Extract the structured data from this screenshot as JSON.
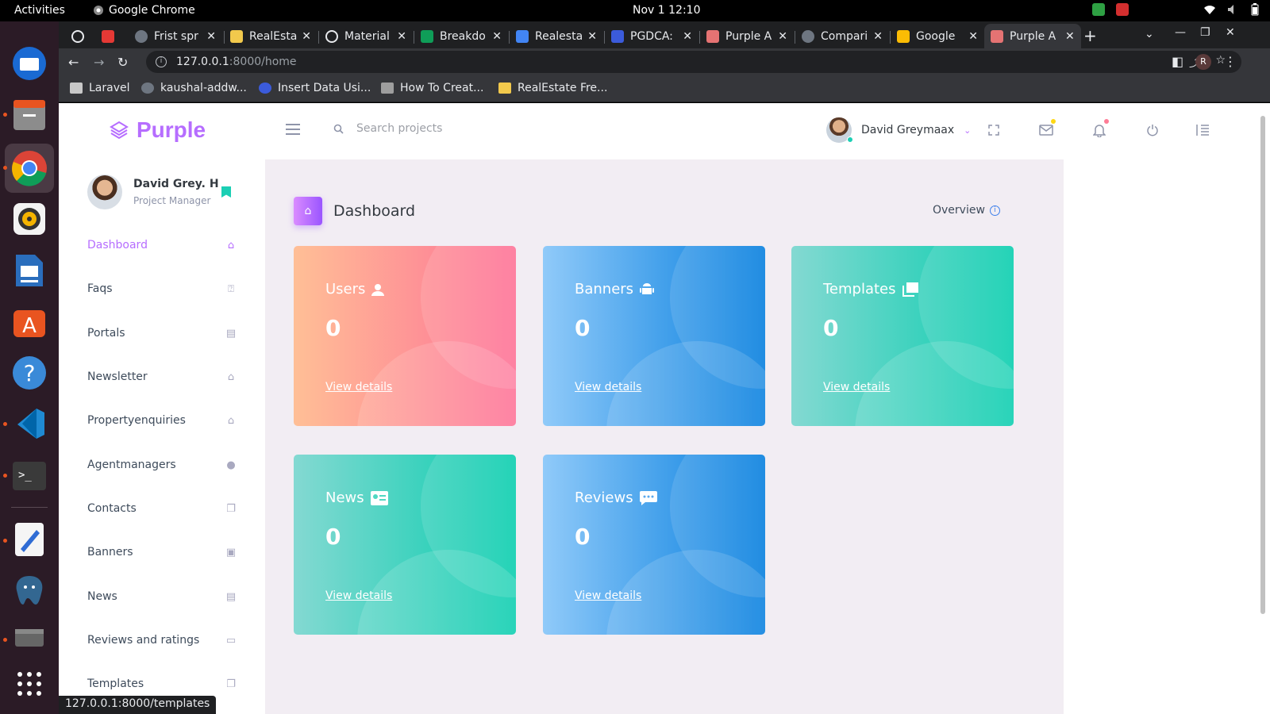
{
  "system": {
    "activities": "Activities",
    "app_name": "Google Chrome",
    "clock": "Nov 1  12:10"
  },
  "browser": {
    "tabs": [
      {
        "title": "",
        "color": "#e8eaed"
      },
      {
        "title": "",
        "color": "#e53935"
      },
      {
        "title": "Frist spr",
        "color": "#6e7681"
      },
      {
        "title": "RealEsta",
        "color": "#f2c94c"
      },
      {
        "title": "Material",
        "color": "#e8eaed"
      },
      {
        "title": "Breakdo",
        "color": "#0f9d58"
      },
      {
        "title": "Realesta",
        "color": "#4285f4"
      },
      {
        "title": "PGDCA:",
        "color": "#3b5bdb"
      },
      {
        "title": "Purple A",
        "color": "#e57373"
      },
      {
        "title": "Compari",
        "color": "#6e7681"
      },
      {
        "title": "Google",
        "color": "#fbbc04"
      },
      {
        "title": "Purple A",
        "color": "#e57373"
      }
    ],
    "url_host": "127.0.0.1",
    "url_path": ":8000/home",
    "profile_initial": "R",
    "bookmarks": [
      "Laravel",
      "kaushal-addw...",
      "Insert Data Usi...",
      "How To Creat...",
      "RealEstate Fre..."
    ],
    "status_url": "127.0.0.1:8000/templates"
  },
  "app": {
    "brand": "Purple",
    "search_placeholder": "Search projects",
    "user_name": "David Greymaax",
    "profile": {
      "name": "David Grey. H",
      "role": "Project Manager"
    },
    "menu": [
      {
        "label": "Dashboard",
        "icon": "home-icon"
      },
      {
        "label": "Faqs",
        "icon": "question-icon"
      },
      {
        "label": "Portals",
        "icon": "id-card-icon"
      },
      {
        "label": "Newsletter",
        "icon": "home-icon"
      },
      {
        "label": "Propertyenquiries",
        "icon": "home-icon"
      },
      {
        "label": "Agentmanagers",
        "icon": "user-icon"
      },
      {
        "label": "Contacts",
        "icon": "copy-icon"
      },
      {
        "label": "Banners",
        "icon": "android-icon"
      },
      {
        "label": "News",
        "icon": "id-card-icon"
      },
      {
        "label": "Reviews and ratings",
        "icon": "message-icon"
      },
      {
        "label": "Templates",
        "icon": "copy-icon"
      }
    ],
    "page_title": "Dashboard",
    "overview": "Overview",
    "cards": [
      {
        "label": "Users",
        "value": "0",
        "link": "View details",
        "icon": "user-icon"
      },
      {
        "label": "Banners",
        "value": "0",
        "link": "View details",
        "icon": "android-icon"
      },
      {
        "label": "Templates",
        "value": "0",
        "link": "View details",
        "icon": "copy-icon"
      },
      {
        "label": "News",
        "value": "0",
        "link": "View details",
        "icon": "id-card-icon"
      },
      {
        "label": "Reviews",
        "value": "0",
        "link": "View details",
        "icon": "message-icon"
      }
    ],
    "colors": {
      "accent": "#b66dff",
      "danger_from": "#ffbf96",
      "danger_to": "#fe7096",
      "info_from": "#90caf9",
      "info_to": "#047edf",
      "success_from": "#84d9d2",
      "success_to": "#07cdae"
    }
  }
}
